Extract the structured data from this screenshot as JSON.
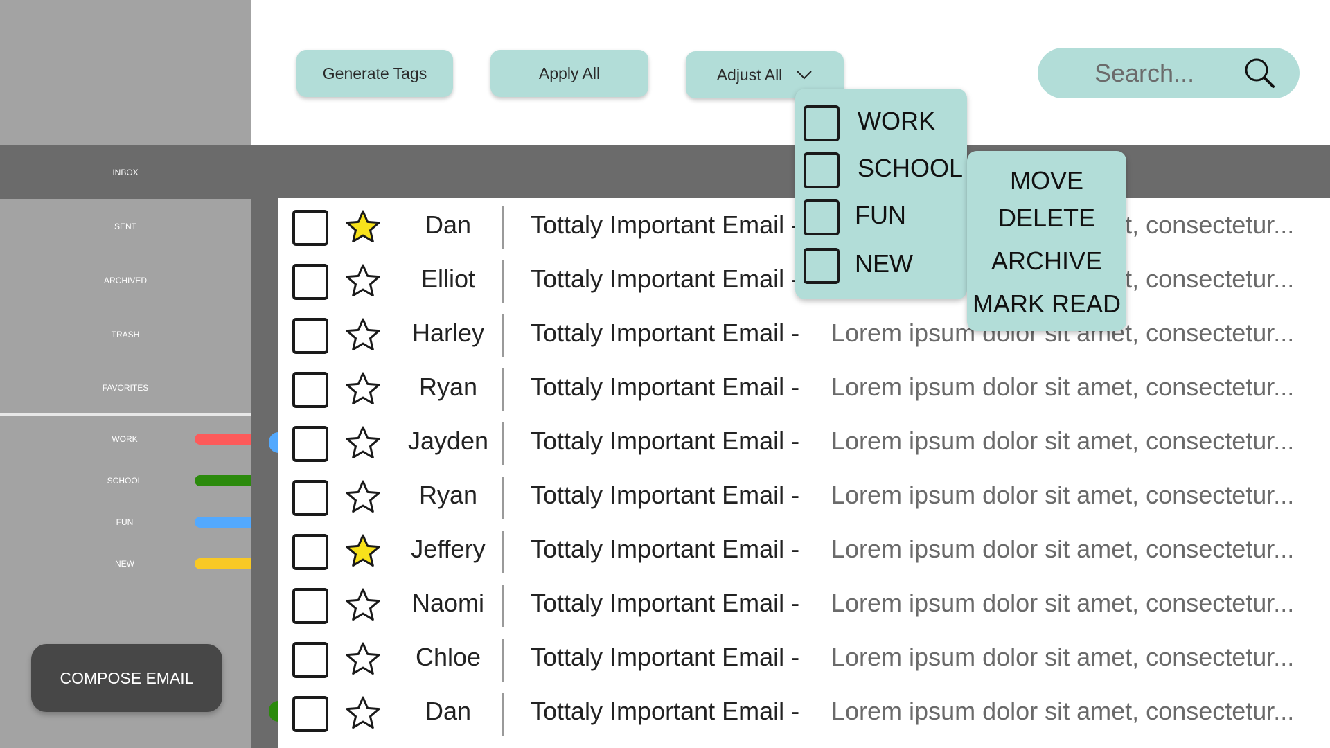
{
  "sidebar": {
    "nav": [
      {
        "label": "INBOX",
        "active": true
      },
      {
        "label": "SENT",
        "active": false
      },
      {
        "label": "ARCHIVED",
        "active": false
      },
      {
        "label": "TRASH",
        "active": false
      },
      {
        "label": "FAVORITES",
        "active": false
      }
    ],
    "tags": [
      {
        "label": "WORK",
        "color": "#fd5a5a"
      },
      {
        "label": "SCHOOL",
        "color": "#2b8a0c"
      },
      {
        "label": "FUN",
        "color": "#53a9fe"
      },
      {
        "label": "NEW",
        "color": "#f8c925"
      }
    ],
    "compose_label": "COMPOSE EMAIL"
  },
  "toolbar": {
    "generate_tags": "Generate Tags",
    "apply_all": "Apply All",
    "adjust_all": "Adjust All"
  },
  "search": {
    "placeholder": "Search..."
  },
  "tag_menu": {
    "options": [
      "WORK",
      "SCHOOL",
      "FUN",
      "NEW"
    ]
  },
  "action_menu": {
    "options": [
      "MOVE",
      "DELETE",
      "ARCHIVE",
      "MARK READ"
    ]
  },
  "colors": {
    "accent": "#b2ddd8",
    "star_filled": "#f8e21b",
    "sidebar": "#a3a3a3",
    "active": "#6b6b6b"
  },
  "emails": [
    {
      "sender": "Dan",
      "starred": true,
      "subject": "Tottaly Important Email -",
      "snippet": "Lorem ipsum dolor sit amet, consectetur..."
    },
    {
      "sender": "Elliot",
      "starred": false,
      "subject": "Tottaly Important Email -",
      "snippet": "Lorem ipsum dolor sit amet, consectetur..."
    },
    {
      "sender": "Harley",
      "starred": false,
      "subject": "Tottaly Important Email -",
      "snippet": "Lorem ipsum dolor sit amet, consectetur..."
    },
    {
      "sender": "Ryan",
      "starred": false,
      "subject": "Tottaly Important Email -",
      "snippet": "Lorem ipsum dolor sit amet, consectetur..."
    },
    {
      "sender": "Jayden",
      "starred": false,
      "subject": "Tottaly Important Email -",
      "snippet": "Lorem ipsum dolor sit amet, consectetur..."
    },
    {
      "sender": "Ryan",
      "starred": false,
      "subject": "Tottaly Important Email -",
      "snippet": "Lorem ipsum dolor sit amet, consectetur..."
    },
    {
      "sender": "Jeffery",
      "starred": true,
      "subject": "Tottaly Important Email -",
      "snippet": "Lorem ipsum dolor sit amet, consectetur..."
    },
    {
      "sender": "Naomi",
      "starred": false,
      "subject": "Tottaly Important Email -",
      "snippet": "Lorem ipsum dolor sit amet, consectetur..."
    },
    {
      "sender": "Chloe",
      "starred": false,
      "subject": "Tottaly Important Email -",
      "snippet": "Lorem ipsum dolor sit amet, consectetur..."
    },
    {
      "sender": "Dan",
      "starred": false,
      "subject": "Tottaly Important Email -",
      "snippet": "Lorem ipsum dolor sit amet, consectetur..."
    }
  ]
}
